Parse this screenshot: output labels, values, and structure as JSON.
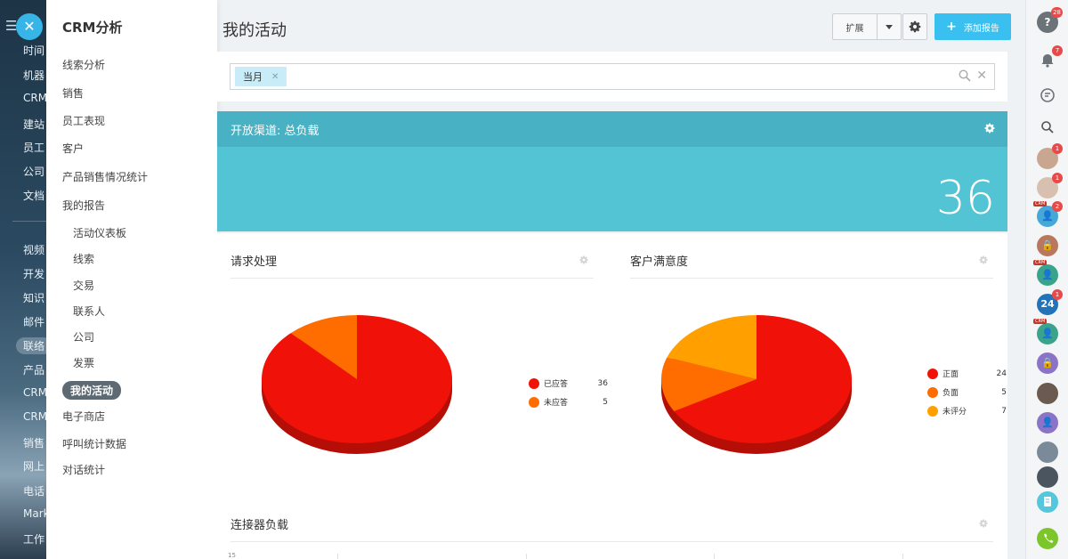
{
  "leftbar": {
    "items": [
      "时间",
      "机器",
      "CRM",
      "建站",
      "员工",
      "公司",
      "文档",
      "视频",
      "开发",
      "知识",
      "邮件",
      "联络",
      "产品",
      "CRM",
      "CRM",
      "销售",
      "网上",
      "电话",
      "Mark",
      "工作"
    ],
    "active_index": 11
  },
  "submenu": {
    "title": "CRM分析",
    "items": [
      {
        "label": "线索分析",
        "level": 0
      },
      {
        "label": "销售",
        "level": 0
      },
      {
        "label": "员工表现",
        "level": 0
      },
      {
        "label": "客户",
        "level": 0
      },
      {
        "label": "产品销售情况统计",
        "level": 0
      },
      {
        "label": "我的报告",
        "level": 0
      },
      {
        "label": "活动仪表板",
        "level": 1
      },
      {
        "label": "线索",
        "level": 1
      },
      {
        "label": "交易",
        "level": 1
      },
      {
        "label": "联系人",
        "level": 1
      },
      {
        "label": "公司",
        "level": 1
      },
      {
        "label": "发票",
        "level": 1
      },
      {
        "label": "我的活动",
        "level": 1,
        "active": true
      },
      {
        "label": "电子商店",
        "level": 0
      },
      {
        "label": "呼叫统计数据",
        "level": 0
      },
      {
        "label": "对话统计",
        "level": 0
      }
    ]
  },
  "header": {
    "title": "我的活动",
    "expand_label": "扩展",
    "add_report_label": "添加报告"
  },
  "filter": {
    "tag": "当月"
  },
  "channel": {
    "title": "开放渠道: 总负载",
    "value": "36"
  },
  "reports": {
    "requests": {
      "title": "请求处理",
      "legend": [
        {
          "label": "已应答",
          "value": "36",
          "color": "#f01208"
        },
        {
          "label": "未应答",
          "value": "5",
          "color": "#ff6d00"
        }
      ]
    },
    "satisfaction": {
      "title": "客户满意度",
      "legend": [
        {
          "label": "正面",
          "value": "24",
          "color": "#f01208"
        },
        {
          "label": "负面",
          "value": "5",
          "color": "#ff6d00"
        },
        {
          "label": "未评分",
          "value": "7",
          "color": "#ffa000"
        }
      ]
    },
    "connector": {
      "title": "连接器负载",
      "axis_first_tick": "15"
    }
  },
  "rightbar": {
    "help_badge": "28",
    "bell_badge": "7",
    "avatar_badges": [
      "1",
      "1",
      "2",
      "",
      "",
      "1"
    ],
    "avatar_24_label": "24",
    "crm_tag": "CRM"
  },
  "colors": {
    "accent": "#39c0f0",
    "channel_head": "#48b1c3",
    "channel_body": "#53c4d4"
  }
}
